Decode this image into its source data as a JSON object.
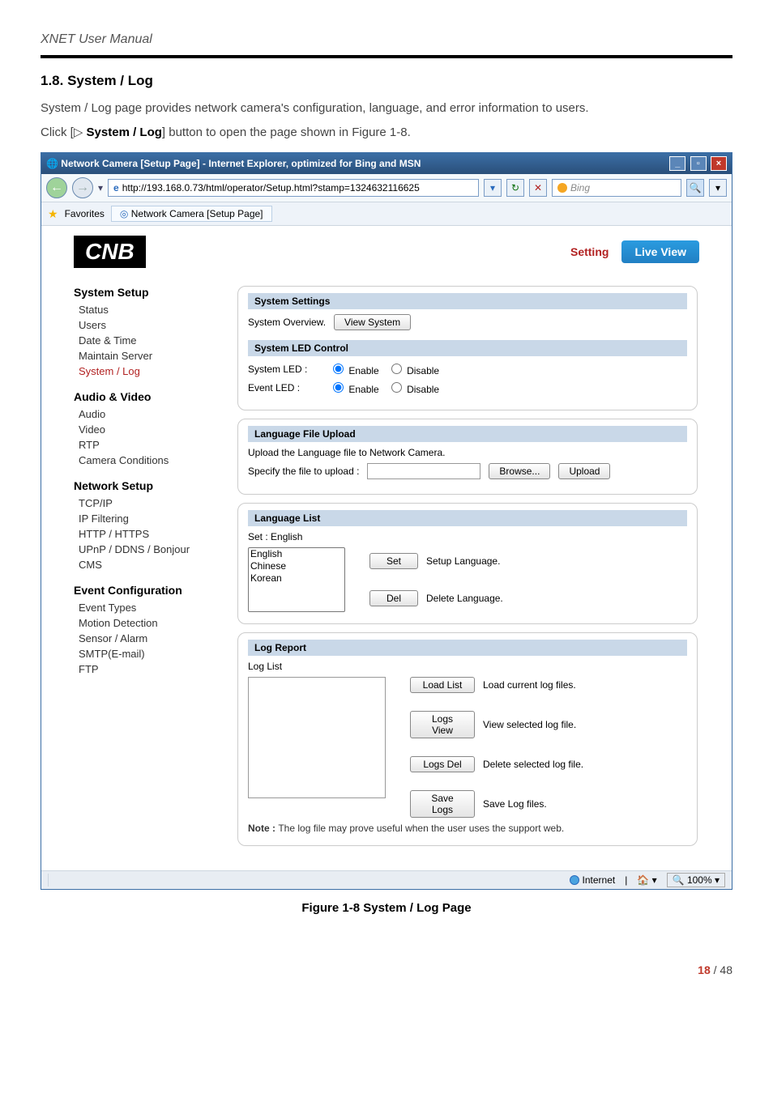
{
  "doc": {
    "manual_title": "XNET User Manual",
    "heading": "1.8. System / Log",
    "intro": "System / Log page provides network camera's configuration, language, and error information to users.",
    "click_prefix": "Click [▷ ",
    "click_bold": "System / Log",
    "click_suffix": "] button to open the page shown in Figure 1-8.",
    "figure_caption": "Figure 1-8 System / Log Page",
    "page_cur": "18",
    "page_sep": " / ",
    "page_total": "48"
  },
  "browser": {
    "title_text": "Network Camera [Setup Page] - Internet Explorer, optimized for Bing and MSN",
    "address": "http://193.168.0.73/html/operator/Setup.html?stamp=1324632116625",
    "bing_placeholder": "Bing",
    "favorites_label": "Favorites",
    "tab_label": "Network Camera [Setup Page]",
    "zone": "Internet",
    "zoom": "100%"
  },
  "app": {
    "logo": "CNB",
    "setting": "Setting",
    "live_view": "Live View"
  },
  "menu": {
    "system_setup": "System Setup",
    "status": "Status",
    "users": "Users",
    "date_time": "Date & Time",
    "maintain_server": "Maintain Server",
    "system_log": "System / Log",
    "audio_video": "Audio & Video",
    "audio": "Audio",
    "video": "Video",
    "rtp": "RTP",
    "camera_cond": "Camera Conditions",
    "network_setup": "Network Setup",
    "tcpip": "TCP/IP",
    "ipfilter": "IP Filtering",
    "https": "HTTP / HTTPS",
    "upnp": "UPnP / DDNS / Bonjour",
    "cms": "CMS",
    "event_conf": "Event Configuration",
    "event_types": "Event Types",
    "motion": "Motion Detection",
    "sensor": "Sensor / Alarm",
    "smtp": "SMTP(E-mail)",
    "ftp": "FTP"
  },
  "settings": {
    "sys_settings": "System Settings",
    "sys_overview": "System Overview.",
    "view_system": "View System",
    "led_control": "System LED Control",
    "system_led": "System LED :",
    "event_led": "Event LED :",
    "enable": "Enable",
    "disable": "Disable",
    "lang_upload": "Language File Upload",
    "lang_upload_desc": "Upload the Language file to Network Camera.",
    "specify": "Specify the file to upload :",
    "browse": "Browse...",
    "upload": "Upload",
    "lang_list": "Language List",
    "set_current": "Set : English",
    "set": "Set",
    "del": "Del",
    "setup_lang": "Setup Language.",
    "delete_lang": "Delete Language.",
    "log_report": "Log Report",
    "log_list": "Log List",
    "load_list": "Load List",
    "load_list_desc": "Load current log files.",
    "logs_view": "Logs View",
    "logs_view_desc": "View selected log file.",
    "logs_del": "Logs Del",
    "logs_del_desc": "Delete selected log file.",
    "save_logs": "Save Logs",
    "save_logs_desc": "Save Log files.",
    "note_prefix": "Note : ",
    "note_text": "The log file may prove useful when the user uses the support web.",
    "languages": [
      "English",
      "Chinese",
      "Korean"
    ]
  }
}
